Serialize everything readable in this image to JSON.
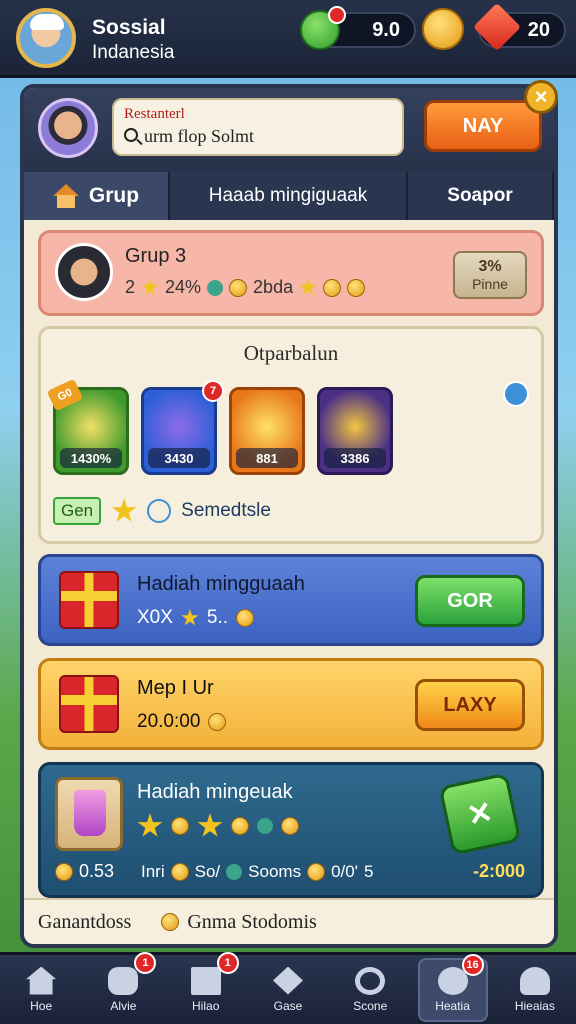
{
  "header": {
    "brand_line1": "Sossial",
    "brand_line2": "Indanesia",
    "currency_green": "9.0",
    "currency_gold": "",
    "currency_gems": "20"
  },
  "search": {
    "label": "Restanterl",
    "text": "urm flop Solmt",
    "nav_button": "NAY"
  },
  "tabs": [
    {
      "label": "Grup"
    },
    {
      "label": "Haaab mingiguaak"
    },
    {
      "label": "Soapor"
    }
  ],
  "group_card": {
    "title": "Grup 3",
    "stats_a": "2",
    "stats_b": "24%",
    "stats_c": "2bda",
    "prime_top": "3%",
    "prime_bottom": "Pinne"
  },
  "items_card": {
    "title": "Otparbalun",
    "items": [
      {
        "value": "1430%",
        "corner": "G0"
      },
      {
        "value": "3430",
        "badge": "7"
      },
      {
        "value": "881"
      },
      {
        "value": "3386"
      }
    ],
    "footer_tag": "Gen",
    "footer_text": "Semedtsle"
  },
  "reward_blue": {
    "title": "Hadiah mingguaah",
    "sub_a": "X0X",
    "sub_b": "5..",
    "action": "GOR"
  },
  "reward_yellow": {
    "title": "Mep I Ur",
    "sub": "20.0:00",
    "action": "LAXY"
  },
  "reward_dark": {
    "title": "Hadiah mingeuak",
    "foot_left": "0.53",
    "foot_mid_a": "Inri",
    "foot_mid_b": "So/",
    "foot_mid_c": "Sooms",
    "foot_mid_d": "0/0'",
    "foot_mid_e": "5",
    "foot_right": "-2:000"
  },
  "panel_footer": {
    "left": "Ganantdoss",
    "right": "Gnma Stodomis"
  },
  "bottom_nav": [
    {
      "label": "Hoe",
      "badge": ""
    },
    {
      "label": "Alvie",
      "badge": "1"
    },
    {
      "label": "Hilao",
      "badge": "1"
    },
    {
      "label": "Gase",
      "badge": ""
    },
    {
      "label": "Scone",
      "badge": ""
    },
    {
      "label": "Heatia",
      "badge": "16"
    },
    {
      "label": "Hieaias",
      "badge": ""
    }
  ],
  "colors": {
    "header_bg": "#1b2437",
    "panel_bg": "#f3ead6",
    "accent_orange": "#e96015",
    "accent_green": "#2aa23a",
    "badge_red": "#e02828"
  }
}
